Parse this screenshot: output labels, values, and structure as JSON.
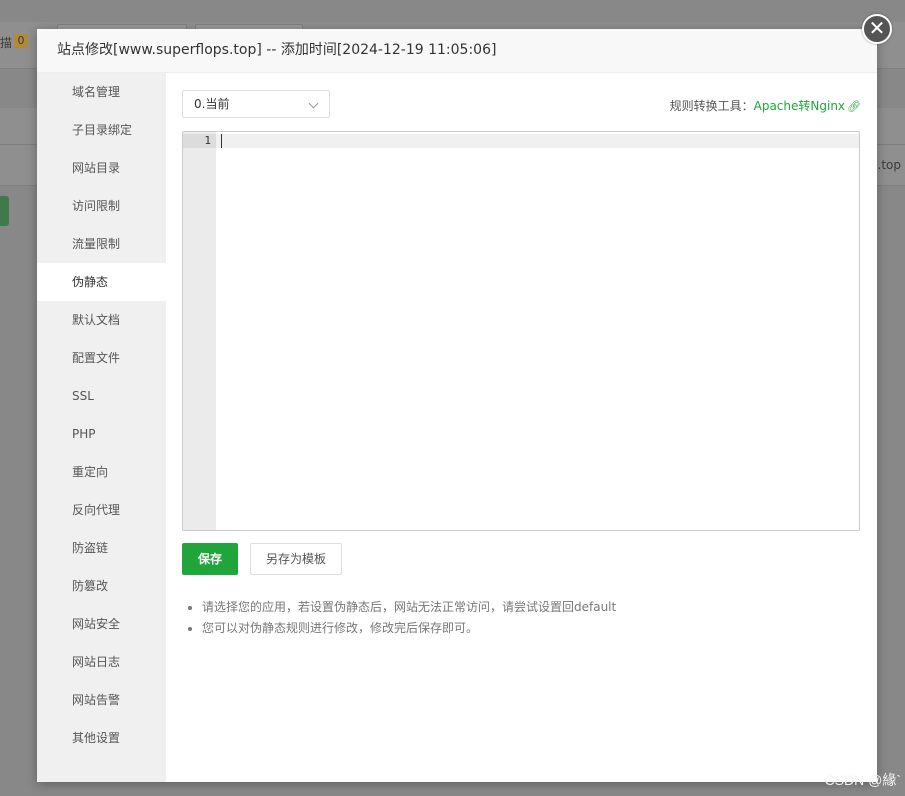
{
  "background": {
    "top_label": "描",
    "badge": "0",
    "right_text": "s.top"
  },
  "modal": {
    "title": "站点修改[www.superflops.top] -- 添加时间[2024-12-19 11:05:06]",
    "close_glyph": "✕",
    "sidebar": {
      "active_index": 5,
      "items": [
        {
          "label": "域名管理"
        },
        {
          "label": "子目录绑定"
        },
        {
          "label": "网站目录"
        },
        {
          "label": "访问限制"
        },
        {
          "label": "流量限制"
        },
        {
          "label": "伪静态"
        },
        {
          "label": "默认文档"
        },
        {
          "label": "配置文件"
        },
        {
          "label": "SSL"
        },
        {
          "label": "PHP"
        },
        {
          "label": "重定向"
        },
        {
          "label": "反向代理"
        },
        {
          "label": "防盗链"
        },
        {
          "label": "防篡改"
        },
        {
          "label": "网站安全"
        },
        {
          "label": "网站日志"
        },
        {
          "label": "网站告警"
        },
        {
          "label": "其他设置"
        }
      ]
    },
    "rewrite": {
      "template_select": "0.当前",
      "tool_label": "规则转换工具：",
      "tool_link": "Apache转Nginx",
      "editor": {
        "line_numbers": [
          "1"
        ],
        "content": ""
      },
      "save_button": "保存",
      "save_as_template_button": "另存为模板",
      "tips": [
        "请选择您的应用，若设置伪静态后，网站无法正常访问，请尝试设置回default",
        "您可以对伪静态规则进行修改，修改完后保存即可。"
      ]
    }
  },
  "watermark": "CSDN @緣`",
  "colors": {
    "accent": "#20a53a",
    "overlay": "#888888",
    "sidebar_bg": "#f0f0f0"
  }
}
